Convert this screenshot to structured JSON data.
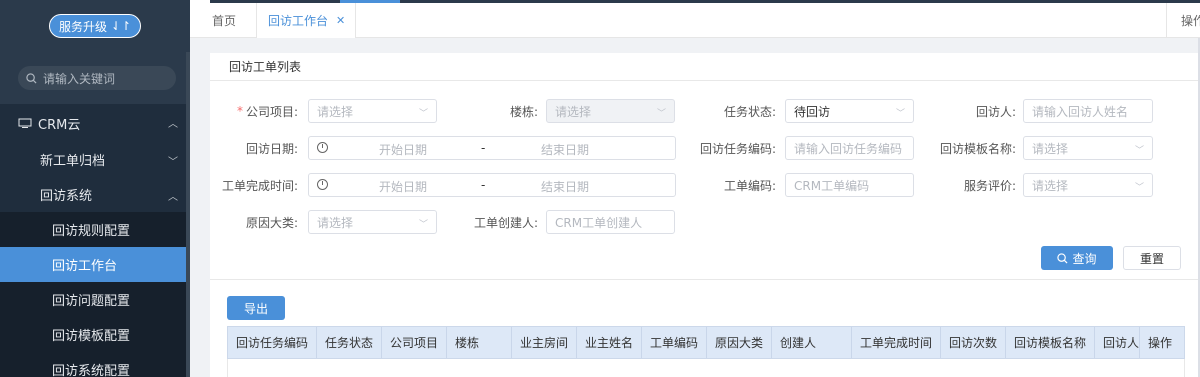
{
  "sidebar": {
    "upgrade_label": "服务升级",
    "search_placeholder": "请输入关键词",
    "menu": [
      {
        "label": "CRM云",
        "level": 1,
        "expanded": true
      },
      {
        "label": "新工单归档",
        "level": 2,
        "expanded": false
      },
      {
        "label": "回访系统",
        "level": 2,
        "expanded": true
      },
      {
        "label": "回访规则配置",
        "level": 3
      },
      {
        "label": "回访工作台",
        "level": 3,
        "active": true
      },
      {
        "label": "回访问题配置",
        "level": 3
      },
      {
        "label": "回访模板配置",
        "level": 3
      },
      {
        "label": "回访系统配置",
        "level": 3
      }
    ]
  },
  "tabs": {
    "home": "首页",
    "active": "回访工作台",
    "ops": "操作"
  },
  "panel": {
    "title": "回访工单列表"
  },
  "form": {
    "company_label": "公司项目:",
    "company_placeholder": "请选择",
    "building_label": "楼栋:",
    "building_placeholder": "请选择",
    "task_status_label": "任务状态:",
    "task_status_value": "待回访",
    "visitor_label": "回访人:",
    "visitor_placeholder": "请输入回访人姓名",
    "visit_date_label": "回访日期:",
    "start_date": "开始日期",
    "date_sep": "-",
    "end_date": "结束日期",
    "task_code_label": "回访任务编码:",
    "task_code_placeholder": "请输入回访任务编码",
    "template_label": "回访模板名称:",
    "template_placeholder": "请选择",
    "finish_time_label": "工单完成时间:",
    "order_code_label": "工单编码:",
    "order_code_placeholder": "CRM工单编码",
    "rating_label": "服务评价:",
    "rating_placeholder": "请选择",
    "reason_label": "原因大类:",
    "reason_placeholder": "请选择",
    "creator_label": "工单创建人:",
    "creator_placeholder": "CRM工单创建人"
  },
  "buttons": {
    "query": "查询",
    "reset": "重置",
    "export": "导出"
  },
  "table": {
    "columns": [
      "回访任务编码",
      "任务状态",
      "公司项目",
      "楼栋",
      "业主房间",
      "业主姓名",
      "工单编码",
      "原因大类",
      "创建人",
      "工单完成时间",
      "回访次数",
      "回访模板名称",
      "回访人",
      "操作"
    ]
  }
}
